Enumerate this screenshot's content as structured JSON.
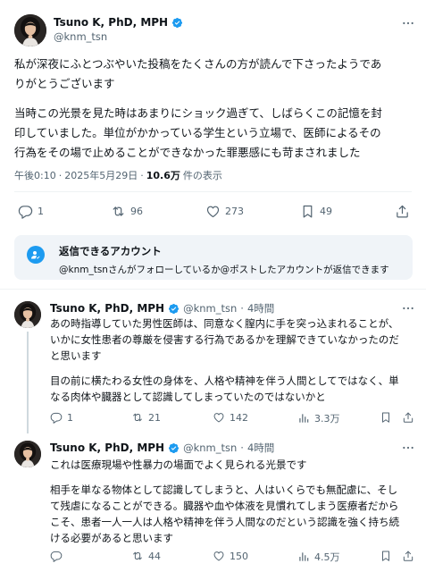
{
  "main_post": {
    "author": {
      "name": "Tsuno K, PhD, MPH",
      "handle": "@knm_tsn"
    },
    "paragraphs": [
      [
        "私が深夜にふとつぶやいた投稿をたくさんの方が読んで下さったようであ",
        "りがとうございます"
      ],
      [
        "当時この光景を見た時はあまりにショック過ぎて、しばらくこの記憶を封",
        "印していました。単位がかかっている学生という立場で、医師によるその",
        "行為をその場で止めることができなかった罪悪感にも苛まされました"
      ]
    ],
    "meta": {
      "time": "午後0:10",
      "separator": "·",
      "date": "2025年5月29日",
      "views_count": "10.6万",
      "views_label": "件の表示"
    },
    "stats": {
      "replies": "1",
      "reposts": "96",
      "likes": "273",
      "bookmarks": "49"
    }
  },
  "reply_notice": {
    "title": "返信できるアカウント",
    "description": "@knm_tsnさんがフォローしているか@ポストしたアカウントが返信できます"
  },
  "replies": [
    {
      "name": "Tsuno K, PhD, MPH",
      "handle": "@knm_tsn",
      "separator": "·",
      "time": "4時間",
      "paragraphs": [
        [
          "あの時指導していた男性医師は、同意なく膣内に手を突っ込まれることが、",
          "いかに女性患者の尊厳を侵害する行為であるかを理解できていなかったのだ",
          "と思います"
        ],
        [
          "目の前に横たわる女性の身体を、人格や精神を伴う人間としてではなく、単",
          "なる肉体や臓器として認識してしまっていたのではないかと"
        ]
      ],
      "stats": {
        "replies": "1",
        "reposts": "21",
        "likes": "142",
        "views": "3.3万"
      }
    },
    {
      "name": "Tsuno K, PhD, MPH",
      "handle": "@knm_tsn",
      "separator": "·",
      "time": "4時間",
      "paragraphs": [
        [
          "これは医療現場や性暴力の場面でよく見られる光景です"
        ],
        [
          "相手を単なる物体として認識してしまうと、人はいくらでも無配慮に、そし",
          "て残虐になることができる。臓器や血や体液を見慣れてしまう医療者だから",
          "こそ、患者一人一人は人格や精神を伴う人間なのだという認識を強く持ち続",
          "ける必要があると思います"
        ]
      ],
      "stats": {
        "replies": "",
        "reposts": "44",
        "likes": "150",
        "views": "4.5万"
      }
    }
  ],
  "colors": {
    "text": "#0f1419",
    "secondary": "#536471",
    "accent": "#1d9bf0",
    "notice_bg": "#f0f4f8"
  },
  "icons": [
    "verified-badge-icon",
    "more-options-icon",
    "reply-icon",
    "repost-icon",
    "like-icon",
    "bookmark-icon",
    "share-icon",
    "views-icon",
    "reply-permission-icon"
  ]
}
